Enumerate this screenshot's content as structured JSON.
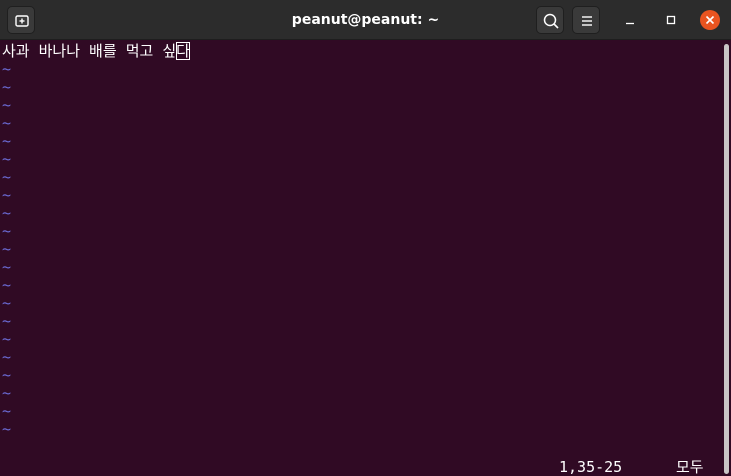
{
  "window": {
    "title": "peanut@peanut: ~"
  },
  "titlebar": {
    "new_tab_icon": "new-tab-icon",
    "search_icon": "search-icon",
    "menu_icon": "hamburger-menu-icon",
    "minimize_icon": "minimize-icon",
    "maximize_icon": "maximize-icon",
    "close_icon": "close-icon",
    "close_color": "#e95420"
  },
  "editor": {
    "text_before_cursor": "사과 바나나 배를 먹고 싶",
    "cursor_char": "다",
    "empty_line_marker": "~",
    "empty_line_count": 21
  },
  "status": {
    "position": "1,35-25",
    "scroll": "모두"
  },
  "colors": {
    "background": "#300a24",
    "foreground": "#ffffff",
    "tilde": "#6b6bd6",
    "titlebar": "#2c2c2c"
  }
}
